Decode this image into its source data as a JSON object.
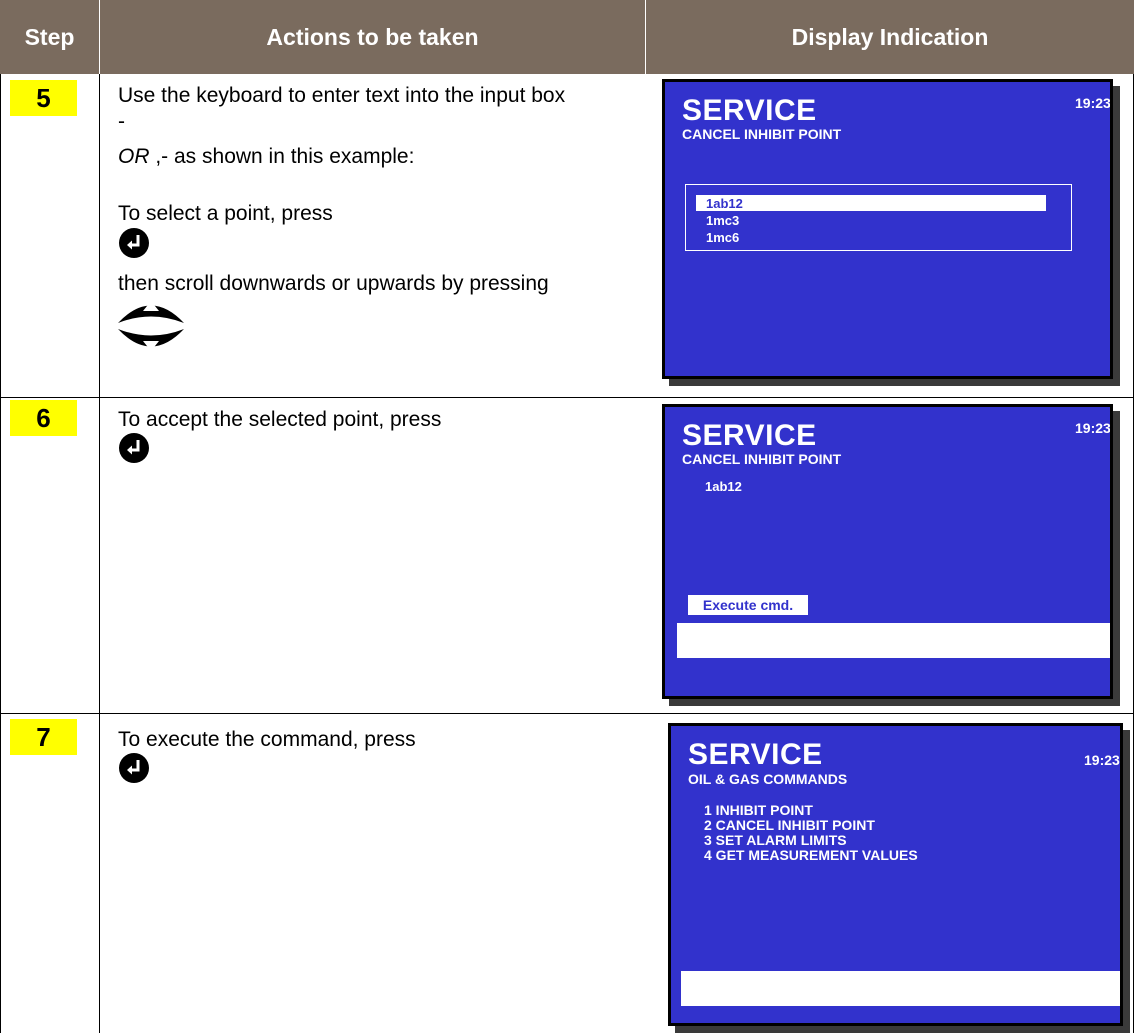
{
  "header": {
    "col_step": "Step",
    "col_actions": "Actions to be taken",
    "col_display": "Display Indication"
  },
  "rows": [
    {
      "step": "5",
      "lines": [
        "Use the keyboard to enter text into the input box",
        "-",
        "OR ,- as shown in this example:",
        "To select a point, press",
        "then scroll downwards or upwards by pressing"
      ],
      "screen": {
        "title": "SERVICE",
        "time": "19:23",
        "subtitle": "CANCEL INHIBIT POINT",
        "list": [
          "1ab12",
          "1mc3",
          "1mc6"
        ]
      }
    },
    {
      "step": "6",
      "lines": [
        "To accept the selected point, press"
      ],
      "screen": {
        "title": "SERVICE",
        "time": "19:23",
        "subtitle": "CANCEL INHIBIT POINT",
        "value": "1ab12",
        "button": "Execute cmd."
      }
    },
    {
      "step": "7",
      "lines": [
        "To execute the command, press"
      ],
      "screen": {
        "title": "SERVICE",
        "time": "19:23",
        "subtitle": "OIL & GAS COMMANDS",
        "menu": [
          "1 INHIBIT POINT",
          "2 CANCEL INHIBIT POINT",
          "3 SET ALARM LIMITS",
          "4 GET MEASUREMENT VALUES"
        ]
      }
    }
  ],
  "icons": {
    "enter": "enter-key-icon",
    "up": "scroll-up-icon",
    "down": "scroll-down-icon"
  }
}
